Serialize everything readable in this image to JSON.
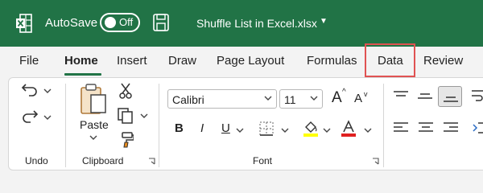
{
  "titlebar": {
    "autosave_label": "AutoSave",
    "toggle_state": "Off",
    "document_title": "Shuffle List in Excel.xlsx",
    "title_dropdown_icon": "chevron-down-icon",
    "logo_icon": "excel-logo-icon",
    "save_icon": "save-icon",
    "accent_color": "#217346"
  },
  "tabs": [
    {
      "label": "File"
    },
    {
      "label": "Home",
      "active": true
    },
    {
      "label": "Insert"
    },
    {
      "label": "Draw"
    },
    {
      "label": "Page Layout"
    },
    {
      "label": "Formulas"
    },
    {
      "label": "Data",
      "highlighted": true
    },
    {
      "label": "Review"
    }
  ],
  "highlight_color": "#e05252",
  "ribbon": {
    "undo_group": {
      "label": "Undo",
      "undo_icon": "undo-icon",
      "redo_icon": "redo-icon"
    },
    "clipboard_group": {
      "label": "Clipboard",
      "paste_label": "Paste",
      "cut_icon": "scissors-icon",
      "copy_icon": "copy-icon",
      "format_painter_icon": "format-painter-icon"
    },
    "font_group": {
      "label": "Font",
      "font_name": "Calibri",
      "font_size": "11",
      "bold": "B",
      "italic": "I",
      "underline": "U",
      "grow_font": "A",
      "shrink_font": "A",
      "fill_color": "#ffff00",
      "font_color": "#e02020"
    },
    "alignment_group": {
      "icons": [
        "align-top-icon",
        "align-middle-icon",
        "align-bottom-icon",
        "align-left-icon",
        "align-center-icon",
        "align-right-icon"
      ]
    }
  }
}
